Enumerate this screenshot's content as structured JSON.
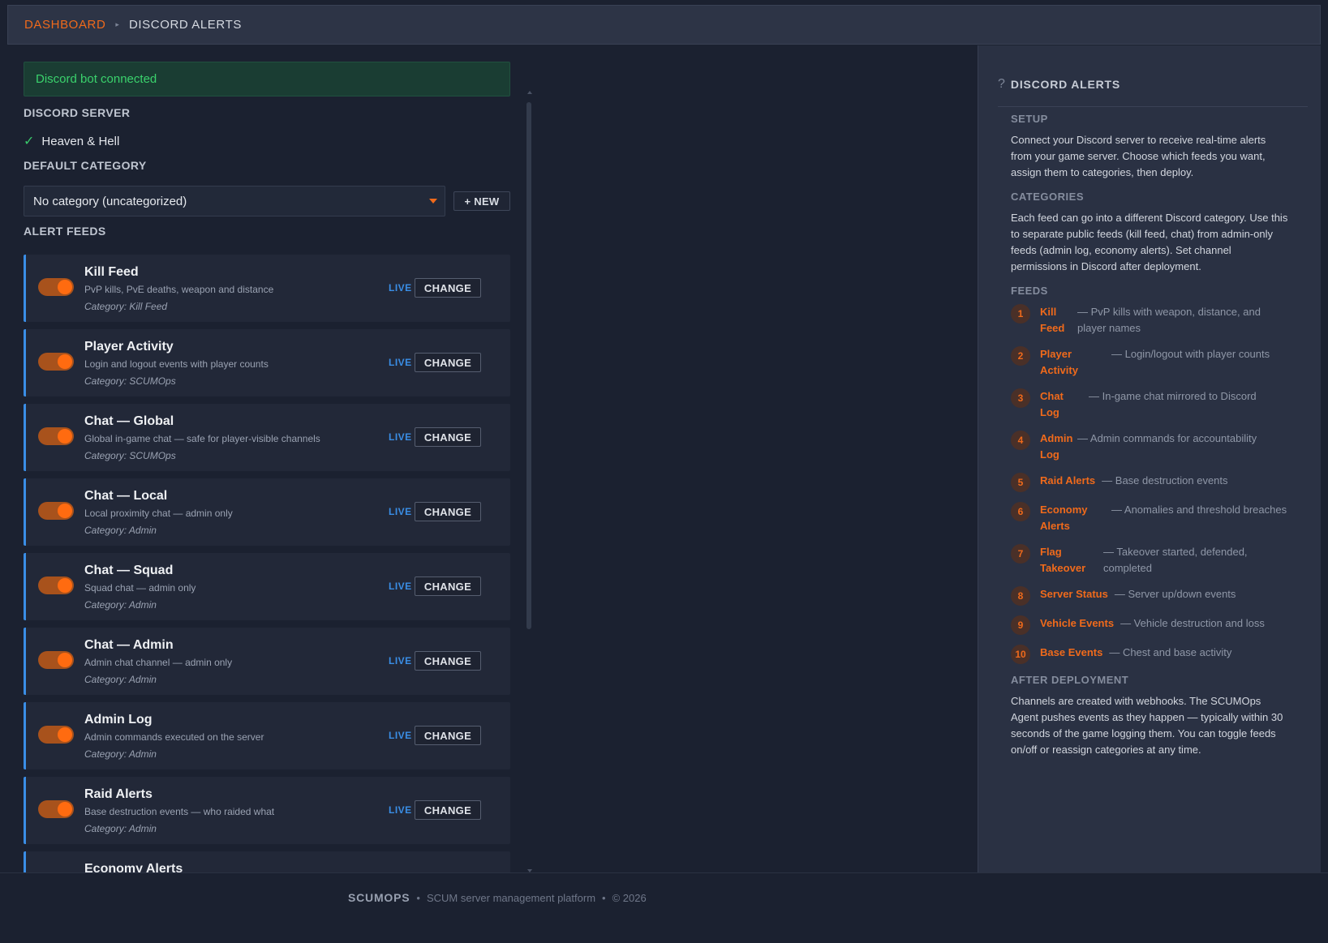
{
  "breadcrumb": {
    "home": "DASHBOARD",
    "separator": "▸",
    "current": "DISCORD ALERTS"
  },
  "banner": {
    "text": "Discord bot connected",
    "color": "#3ad26c"
  },
  "server": {
    "label": "DISCORD SERVER",
    "check": "✓",
    "name": "Heaven & Hell"
  },
  "category": {
    "label": "DEFAULT CATEGORY",
    "selected": "No category (uncategorized)",
    "new_button": "+ NEW"
  },
  "feeds": {
    "label": "ALERT FEEDS",
    "items": [
      {
        "title": "Kill Feed",
        "desc": "PvP kills, PvE deaths, weapon and distance",
        "category": "Category: Kill Feed",
        "status": "LIVE",
        "action": "CHANGE",
        "enabled": true
      },
      {
        "title": "Player Activity",
        "desc": "Login and logout events with player counts",
        "category": "Category: SCUMOps",
        "status": "LIVE",
        "action": "CHANGE",
        "enabled": true
      },
      {
        "title": "Chat — Global",
        "desc": "Global in-game chat — safe for player-visible channels",
        "category": "Category: SCUMOps",
        "status": "LIVE",
        "action": "CHANGE",
        "enabled": true
      },
      {
        "title": "Chat — Local",
        "desc": "Local proximity chat — admin only",
        "category": "Category: Admin",
        "status": "LIVE",
        "action": "CHANGE",
        "enabled": true
      },
      {
        "title": "Chat — Squad",
        "desc": "Squad chat — admin only",
        "category": "Category: Admin",
        "status": "LIVE",
        "action": "CHANGE",
        "enabled": true
      },
      {
        "title": "Chat — Admin",
        "desc": "Admin chat channel — admin only",
        "category": "Category: Admin",
        "status": "LIVE",
        "action": "CHANGE",
        "enabled": true
      },
      {
        "title": "Admin Log",
        "desc": "Admin commands executed on the server",
        "category": "Category: Admin",
        "status": "LIVE",
        "action": "CHANGE",
        "enabled": true
      },
      {
        "title": "Raid Alerts",
        "desc": "Base destruction events — who raided what",
        "category": "Category: Admin",
        "status": "LIVE",
        "action": "CHANGE",
        "enabled": true
      },
      {
        "title": "Economy Alerts",
        "desc": "",
        "category": "",
        "status": "",
        "action": "",
        "enabled": true
      }
    ]
  },
  "help": {
    "icon": "question-mark-icon",
    "title": "DISCORD ALERTS",
    "setup_label": "SETUP",
    "setup_text": "Connect your Discord server to receive real-time alerts from your game server. Choose which feeds you want, assign them to categories, then deploy.",
    "categories_label": "CATEGORIES",
    "categories_text": "Each feed can go into a different Discord category. Use this to separate public feeds (kill feed, chat) from admin-only feeds (admin log, economy alerts). Set channel permissions in Discord after deployment.",
    "feeds_label": "FEEDS",
    "feed_list": [
      {
        "num": "1",
        "name": "Kill Feed",
        "desc": "— PvP kills with weapon, distance, and player names"
      },
      {
        "num": "2",
        "name": "Player Activity",
        "desc": "— Login/logout with player counts"
      },
      {
        "num": "3",
        "name": "Chat Log",
        "desc": "— In-game chat mirrored to Discord"
      },
      {
        "num": "4",
        "name": "Admin Log",
        "desc": "— Admin commands for accountability"
      },
      {
        "num": "5",
        "name": "Raid Alerts",
        "desc": "— Base destruction events"
      },
      {
        "num": "6",
        "name": "Economy Alerts",
        "desc": "— Anomalies and threshold breaches"
      },
      {
        "num": "7",
        "name": "Flag Takeover",
        "desc": "— Takeover started, defended, completed"
      },
      {
        "num": "8",
        "name": "Server Status",
        "desc": "— Server up/down events"
      },
      {
        "num": "9",
        "name": "Vehicle Events",
        "desc": "— Vehicle destruction and loss"
      },
      {
        "num": "10",
        "name": "Base Events",
        "desc": "— Chest and base activity"
      }
    ],
    "after_label": "AFTER DEPLOYMENT",
    "after_text": "Channels are created with webhooks. The SCUMOps Agent pushes events as they happen — typically within 30 seconds of the game logging them. You can toggle feeds on/off or reassign categories at any time."
  },
  "footer": {
    "brand": "SCUMOPS",
    "sep1": "•",
    "tagline": "SCUM server management platform",
    "sep2": "•",
    "copyright": "© 2026"
  },
  "colors": {
    "accent": "#f06a1b",
    "live": "#3a8ee6",
    "success": "#3ad26c",
    "background": "#1b2130",
    "panel": "#2a3143"
  }
}
